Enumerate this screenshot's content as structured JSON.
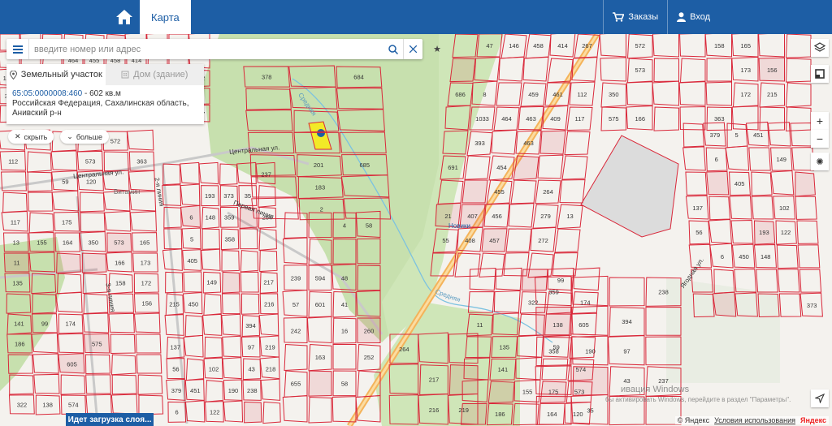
{
  "topbar": {
    "map_tab": "Карта",
    "orders": "Заказы",
    "login": "Вход"
  },
  "search": {
    "placeholder": "введите номер или адрес"
  },
  "info": {
    "tab_land": "Земельный участок",
    "tab_building": "Дом (здание)",
    "cad_number": "65:05:0000008:460",
    "area": " - 602 кв.м",
    "address": "Российская Федерация, Сахалинская область, Анивский р-н"
  },
  "pills": {
    "hide": "скрыть",
    "more": "больше"
  },
  "status": "Идет загрузка слоя...",
  "watermark": {
    "line1": "ивация Windows",
    "line2": "бы активировать Windows, перейдите в раздел \"Параметры\"."
  },
  "copyright": {
    "prefix": "© Яндекс",
    "terms": "Условия использования",
    "brand": "Яндекс"
  },
  "colors": {
    "brand": "#1d5ea5",
    "parcel_stroke": "#d9283a",
    "forest": "#c7e0ae",
    "highlight": "#f2ea27",
    "road": "#f4b35a"
  },
  "map_labels": {
    "streets": [
      "Центральная ул.",
      "Центральная ул.",
      "Первая линия",
      "2-я линия",
      "3-я линия",
      "Средняя",
      "Средняя",
      "Витамин",
      "Ягодная ул.",
      "Новики"
    ],
    "parcels": [
      "1033",
      "393",
      "407",
      "408",
      "146",
      "464",
      "454",
      "455",
      "456",
      "457",
      "458",
      "459",
      "463",
      "463",
      "414",
      "461",
      "409",
      "264",
      "279",
      "272",
      "267",
      "112",
      "117",
      "13",
      "11",
      "135",
      "141",
      "186",
      "322",
      "155",
      "99",
      "138",
      "59",
      "175",
      "164",
      "174",
      "605",
      "574",
      "573",
      "120",
      "350",
      "575",
      "572",
      "573",
      "166",
      "158",
      "363",
      "165",
      "173",
      "172",
      "156",
      "215",
      "137",
      "56",
      "379",
      "6",
      "6",
      "5",
      "405",
      "450",
      "451",
      "193",
      "148",
      "149",
      "102",
      "122",
      "373",
      "359",
      "358",
      "190",
      "35",
      "394",
      "97",
      "43",
      "238",
      "237",
      "264",
      "217",
      "216",
      "219",
      "218",
      "239",
      "57",
      "242",
      "655",
      "594",
      "601",
      "163",
      "4",
      "48",
      "41",
      "16",
      "58",
      "58",
      "260",
      "252",
      "378",
      "201",
      "183",
      "2",
      "684",
      "685",
      "686",
      "691",
      "21",
      "55",
      "47",
      "8"
    ]
  }
}
